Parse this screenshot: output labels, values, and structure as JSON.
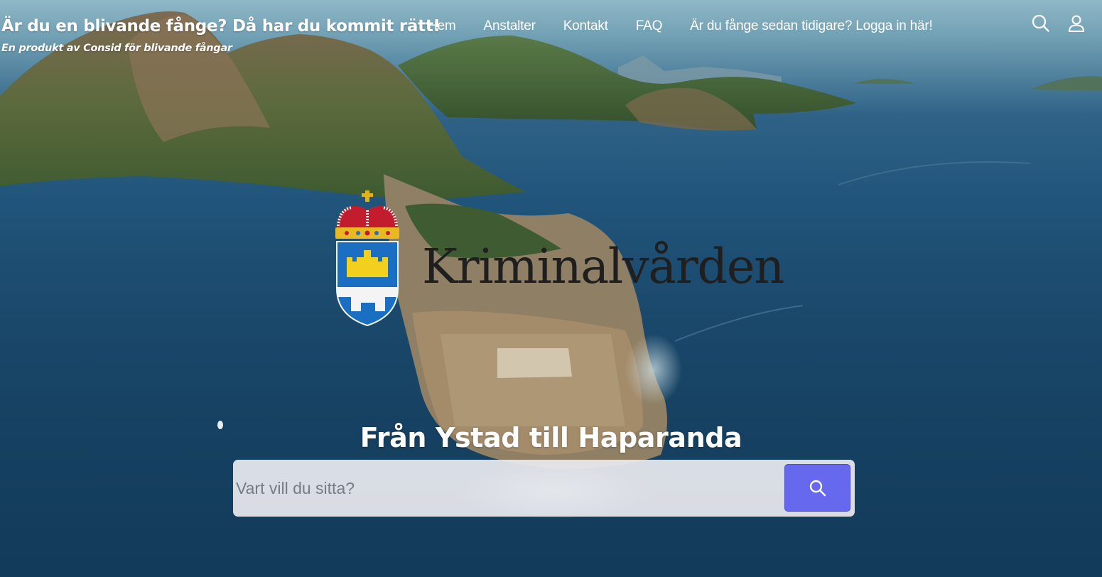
{
  "header": {
    "title": "Är du en blivande fånge? Då har du kommit rätt!",
    "tagline": "En produkt av Consid för blivande fångar",
    "nav": [
      {
        "label": "Hem"
      },
      {
        "label": "Anstalter"
      },
      {
        "label": "Kontakt"
      },
      {
        "label": "FAQ"
      },
      {
        "label": "Är du fånge sedan tidigare? Logga in här!"
      }
    ],
    "icons": [
      "search-icon",
      "user-icon"
    ]
  },
  "logo": {
    "wordmark": "Kriminalvården",
    "emblem": "coat-of-arms"
  },
  "hero": {
    "heading": "Från Ystad till Haparanda",
    "search": {
      "placeholder": "Vart vill du sitta?",
      "value": "",
      "button_icon": "search-icon"
    }
  },
  "colors": {
    "search_button": "#6668ee",
    "text_light": "#ffffff",
    "wordmark": "#1f1f1f"
  }
}
